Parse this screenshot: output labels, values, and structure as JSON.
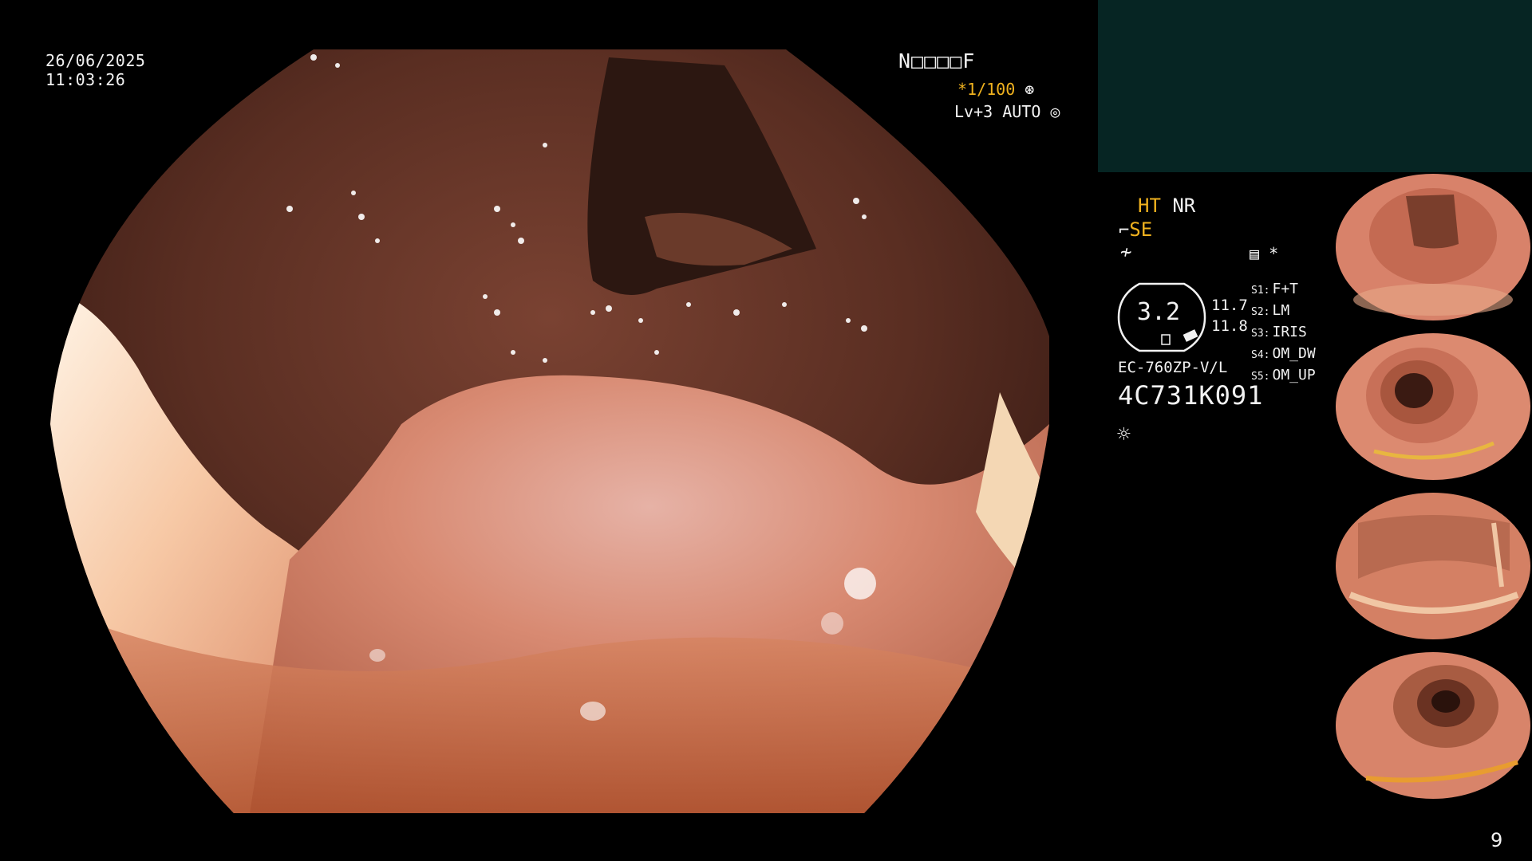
{
  "overlay": {
    "date": "26/06/2025",
    "time": "11:03:26",
    "patient_id": "N□□□□F",
    "zoom": "*1/100",
    "zoom_icon": "shutter-icon",
    "level": "Lv+3 AUTO",
    "level_icon": "iris-icon"
  },
  "panel": {
    "ht_label": "HT",
    "nr_label": "NR",
    "se_label": "SE",
    "memo_star": "*",
    "gauge_value": "3.2",
    "value_1": "11.7",
    "value_2": "11.8",
    "settings": [
      {
        "key": "S1:",
        "value": "F+T"
      },
      {
        "key": "S2:",
        "value": "LM"
      },
      {
        "key": "S3:",
        "value": "IRIS"
      },
      {
        "key": "S4:",
        "value": "OM_DW"
      },
      {
        "key": "S5:",
        "value": "OM_UP"
      }
    ],
    "scope_model": "EC-760ZP-V/L",
    "scope_serial": "4C731K091",
    "page_number": "9"
  },
  "colors": {
    "accent_yellow": "#f0b21f",
    "panel_teal": "#062523",
    "mucosa": "#c8704f"
  }
}
